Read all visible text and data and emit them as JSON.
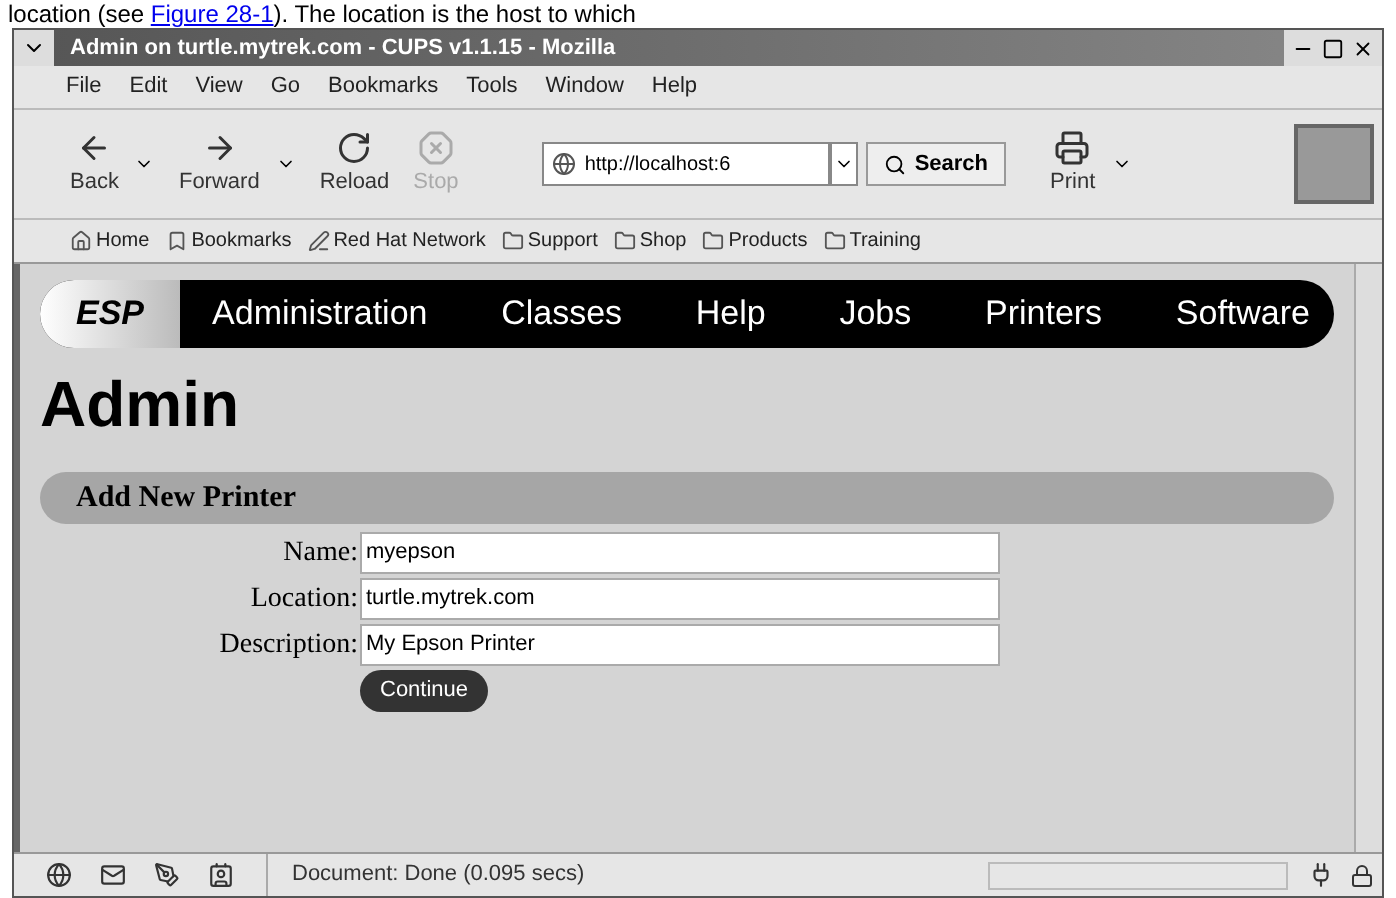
{
  "caption": {
    "before": "location (see ",
    "link": "Figure 28-1",
    "after": "). The location is the host to which"
  },
  "window": {
    "title": "Admin on turtle.mytrek.com - CUPS v1.1.15 - Mozilla"
  },
  "menu": [
    "File",
    "Edit",
    "View",
    "Go",
    "Bookmarks",
    "Tools",
    "Window",
    "Help"
  ],
  "toolbar": [
    {
      "label": "Back",
      "kind": "back",
      "disabled": false,
      "dropdown": true
    },
    {
      "label": "Forward",
      "kind": "forward",
      "disabled": false,
      "dropdown": true
    },
    {
      "label": "Reload",
      "kind": "reload",
      "disabled": false,
      "dropdown": false
    },
    {
      "label": "Stop",
      "kind": "stop",
      "disabled": true,
      "dropdown": false
    }
  ],
  "address": {
    "value": "http://localhost:6"
  },
  "search_button": "Search",
  "print_button": "Print",
  "bookmarks": [
    {
      "label": "Home",
      "kind": "home"
    },
    {
      "label": "Bookmarks",
      "kind": "bookmarks"
    },
    {
      "label": "Red Hat Network",
      "kind": "pen"
    },
    {
      "label": "Support",
      "kind": "folder"
    },
    {
      "label": "Shop",
      "kind": "folder"
    },
    {
      "label": "Products",
      "kind": "folder"
    },
    {
      "label": "Training",
      "kind": "folder"
    }
  ],
  "nav": {
    "brand": "ESP",
    "items": [
      "Administration",
      "Classes",
      "Help",
      "Jobs",
      "Printers",
      "Software"
    ]
  },
  "heading": "Admin",
  "section": "Add New Printer",
  "fields": [
    {
      "label": "Name:",
      "value": "myepson"
    },
    {
      "label": "Location:",
      "value": "turtle.mytrek.com"
    },
    {
      "label": "Description:",
      "value": "My Epson Printer"
    }
  ],
  "continue_button": "Continue",
  "status_bar": "Document: Done (0.095 secs)",
  "progress": {
    "level": 0
  }
}
